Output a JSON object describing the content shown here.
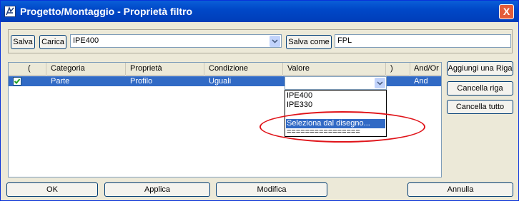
{
  "window": {
    "title": "Progetto/Montaggio - Proprietà filtro",
    "close": "X"
  },
  "toolbar": {
    "save_label": "Salva",
    "load_label": "Carica",
    "filter_value": "IPE400",
    "save_as_label": "Salva come",
    "save_as_value": "FPL"
  },
  "grid": {
    "columns": [
      "(",
      "Categoria",
      "Proprietà",
      "Condizione",
      "Valore",
      ")",
      "And/Or"
    ],
    "row": {
      "checked": true,
      "categoria": "Parte",
      "proprieta": "Profilo",
      "condizione": "Uguali",
      "valore": "",
      "and_or": "And"
    },
    "dropdown_options": [
      "IPE400",
      "IPE330",
      "",
      "Seleziona dal disegno...",
      "================"
    ]
  },
  "side_buttons": {
    "add_row": "Aggiungi una Riga",
    "delete_row": "Cancella riga",
    "delete_all": "Cancella tutto"
  },
  "footer": {
    "ok": "OK",
    "apply": "Applica",
    "modify": "Modifica",
    "cancel": "Annulla"
  },
  "colors": {
    "selection": "#316ac5",
    "highlight_ring": "#e0141a",
    "titlebar": "#0048c8"
  }
}
